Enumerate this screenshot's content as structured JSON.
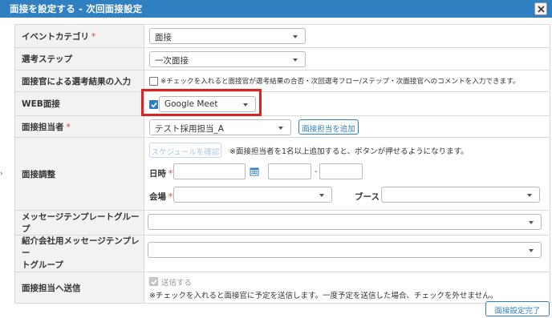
{
  "dialog": {
    "title": "面接を設定する - 次回面接設定"
  },
  "rows": {
    "event_category": {
      "label": "イベントカテゴリ",
      "required": "*",
      "value": "面接"
    },
    "selection_step": {
      "label": "選考ステップ",
      "value": "一次面接"
    },
    "interviewer_input": {
      "label": "面接官による選考結果の入力",
      "note": "※チェックを入れると面接官が選考結果の合否・次回選考フロー/ステップ・次面接官へのコメントを入力できます。"
    },
    "web_interview": {
      "label": "WEB面接",
      "value": "Google Meet"
    },
    "interviewer": {
      "label": "面接担当者",
      "required": "*",
      "value": "テスト採用担当_A",
      "add_button": "面接担当を追加"
    },
    "adjustment": {
      "label": "面接調整",
      "schedule_button": "スケジュールを確認",
      "schedule_note": "※面接担当者を1名以上追加すると、ボタンが押せるようになります。",
      "datetime_label": "日時",
      "datetime_required": "*",
      "time_separator": "-",
      "venue_label": "会場",
      "venue_required": "*",
      "booth_label": "ブース"
    },
    "message_group": {
      "label": "メッセージテンプレートグループ",
      "value": ""
    },
    "agency_message_group": {
      "label_line1": "紹介会社用メッセージテンプレー",
      "label_line2": "トグループ",
      "value": ""
    },
    "send_to_interviewer": {
      "label": "面接担当へ送信",
      "checkbox_label": "送信する",
      "note": "※チェックを入れると面接官に予定を送信します。一度予定を送信した場合、チェックを外せません。"
    }
  },
  "footer": {
    "complete_button": "面接設定完了"
  },
  "colors": {
    "accent": "#2f7fc1",
    "highlight": "#e02020"
  },
  "icons": {
    "close": "close-icon",
    "calendar": "calendar-icon",
    "caret": "chevron-down-icon",
    "check": "checkmark-icon"
  }
}
